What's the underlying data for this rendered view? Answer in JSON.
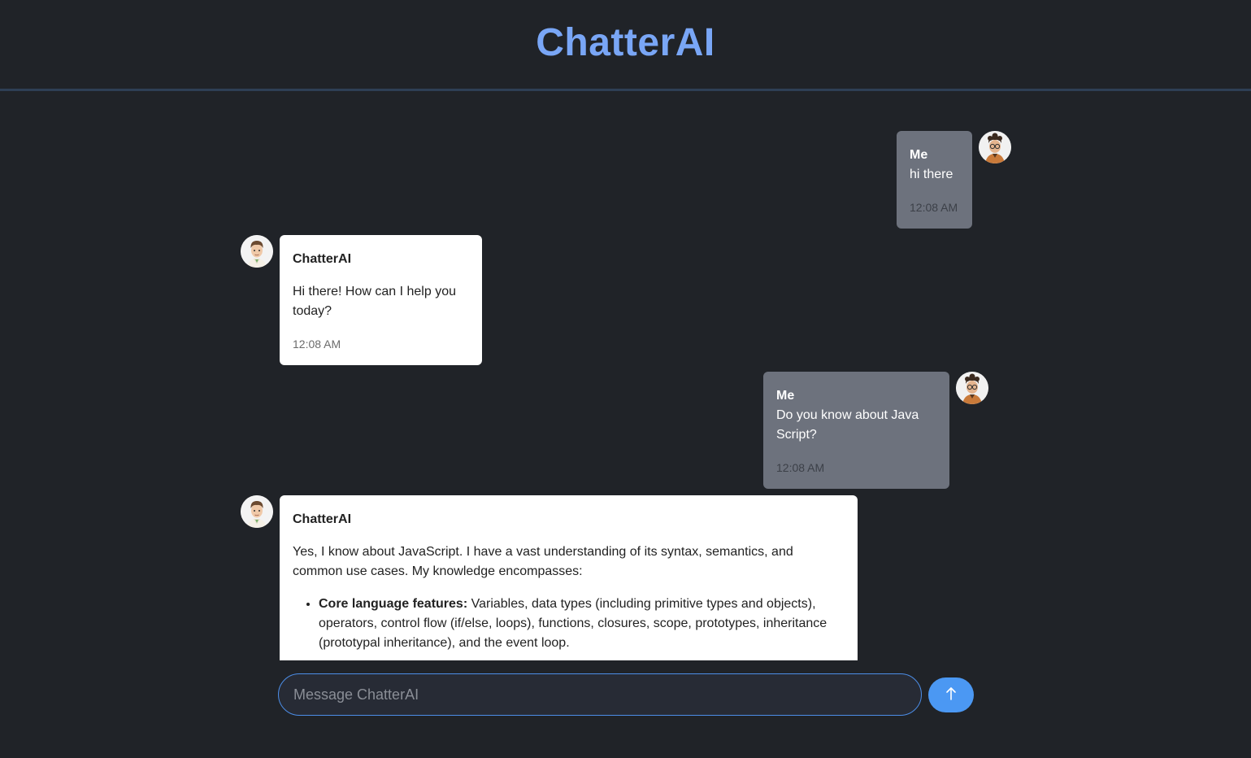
{
  "app": {
    "title": "ChatterAI"
  },
  "messages": [
    {
      "role": "me",
      "sender": "Me",
      "text": "hi there",
      "time": "12:08 AM"
    },
    {
      "role": "ai",
      "sender": "ChatterAI",
      "text": "Hi there! How can I help you today?",
      "time": "12:08 AM"
    },
    {
      "role": "me",
      "sender": "Me",
      "text": "Do you know about Java Script?",
      "time": "12:08 AM"
    },
    {
      "role": "ai",
      "sender": "ChatterAI",
      "text": "Yes, I know about JavaScript. I have a vast understanding of its syntax, semantics, and common use cases. My knowledge encompasses:",
      "bullets": [
        {
          "bold": "Core language features:",
          "text": " Variables, data types (including primitive types and objects), operators, control flow (if/else, loops), functions, closures, scope, prototypes, inheritance (prototypal inheritance), and the event loop."
        }
      ]
    }
  ],
  "composer": {
    "placeholder": "Message ChatterAI",
    "value": ""
  },
  "icons": {
    "send": "arrow-up-icon",
    "user_avatar": "user-avatar-icon",
    "bot_avatar": "bot-avatar-icon"
  },
  "colors": {
    "accent": "#4b98f3",
    "title": "#79a6f6",
    "background": "#202328",
    "user_bubble": "#6d727d"
  }
}
